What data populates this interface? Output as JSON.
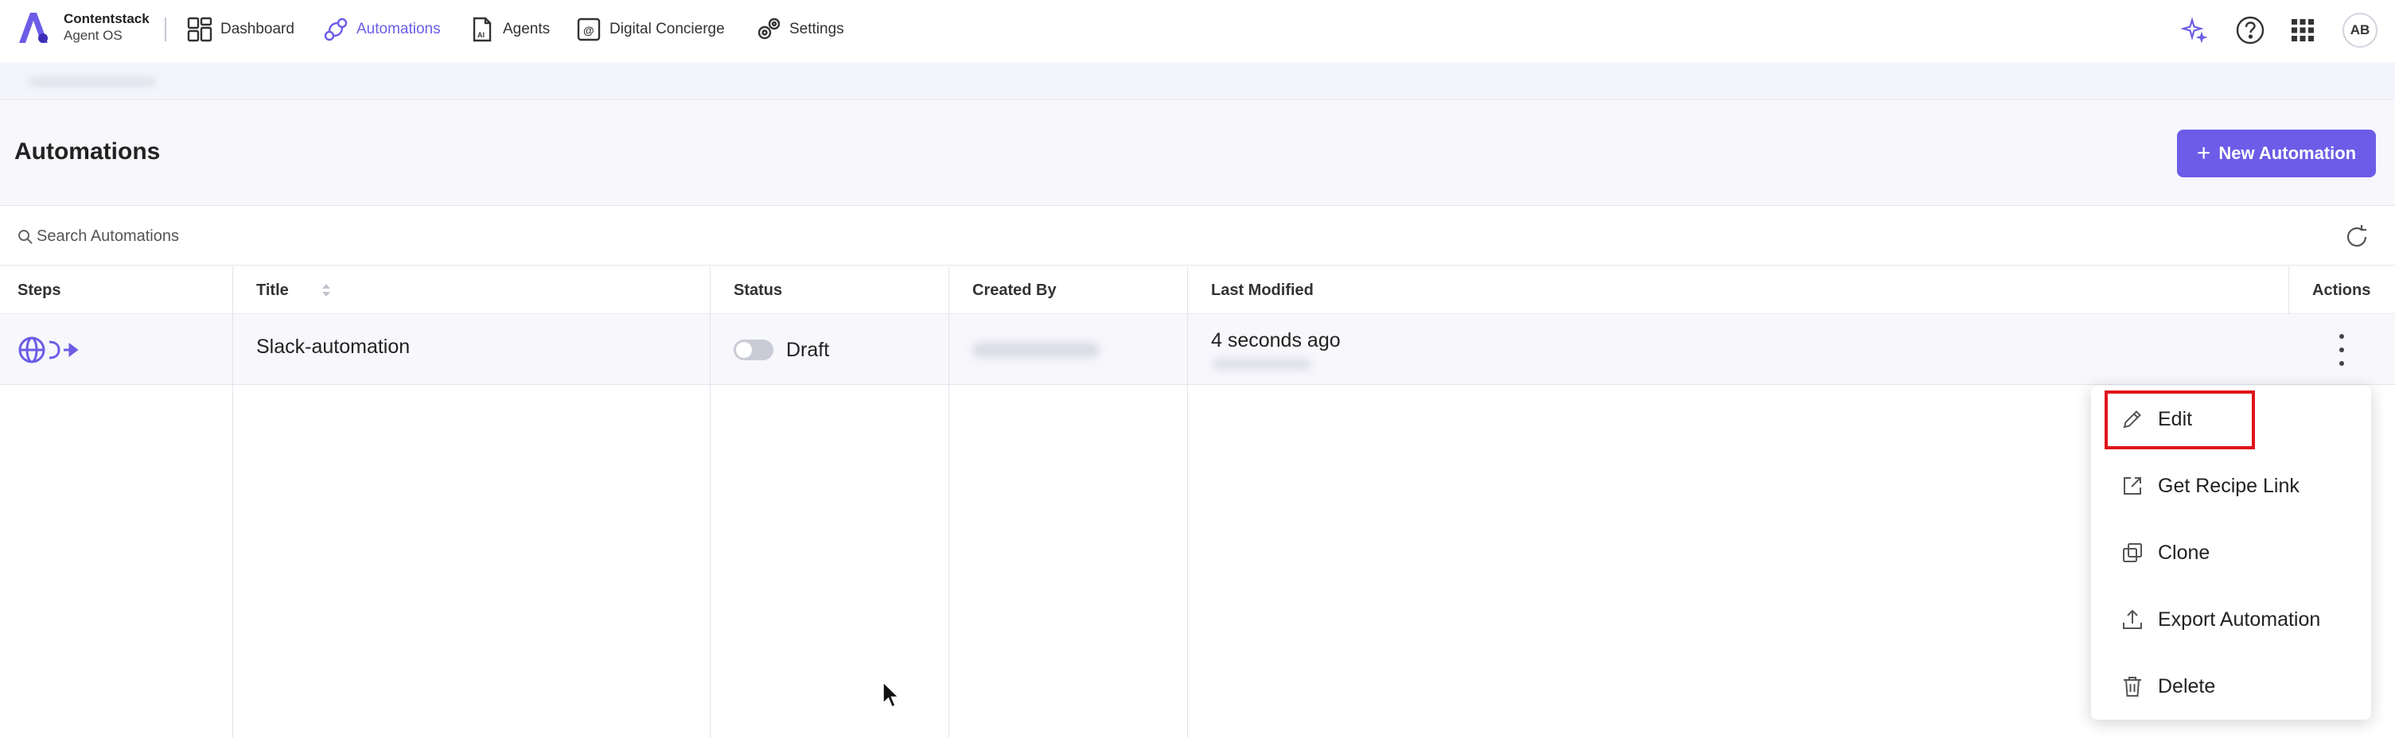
{
  "brand": {
    "name": "Contentstack",
    "subtitle": "Agent OS"
  },
  "nav": {
    "items": [
      {
        "label": "Dashboard",
        "icon": "dashboard-icon",
        "active": false
      },
      {
        "label": "Automations",
        "icon": "automations-icon",
        "active": true
      },
      {
        "label": "Agents",
        "icon": "agents-icon",
        "active": false
      },
      {
        "label": "Digital Concierge",
        "icon": "concierge-icon",
        "active": false
      },
      {
        "label": "Settings",
        "icon": "settings-icon",
        "active": false
      }
    ],
    "right_icons": [
      "sparkle-icon",
      "help-icon",
      "apps-grid-icon"
    ],
    "avatar_initials": "AB"
  },
  "page": {
    "title": "Automations",
    "new_button_label": "New Automation"
  },
  "search": {
    "placeholder": "Search Automations"
  },
  "table": {
    "columns": [
      "Steps",
      "Title",
      "Status",
      "Created By",
      "Last Modified",
      "Actions"
    ],
    "rows": [
      {
        "title": "Slack-automation",
        "status": "Draft",
        "last_modified": "4 seconds ago"
      }
    ]
  },
  "menu": {
    "items": [
      {
        "label": "Edit",
        "icon": "pencil-icon"
      },
      {
        "label": "Get Recipe Link",
        "icon": "external-link-icon"
      },
      {
        "label": "Clone",
        "icon": "clone-icon"
      },
      {
        "label": "Export Automation",
        "icon": "export-icon"
      },
      {
        "label": "Delete",
        "icon": "trash-icon"
      }
    ]
  },
  "colors": {
    "accent": "#6c5ce7",
    "highlight": "#e0131b"
  }
}
